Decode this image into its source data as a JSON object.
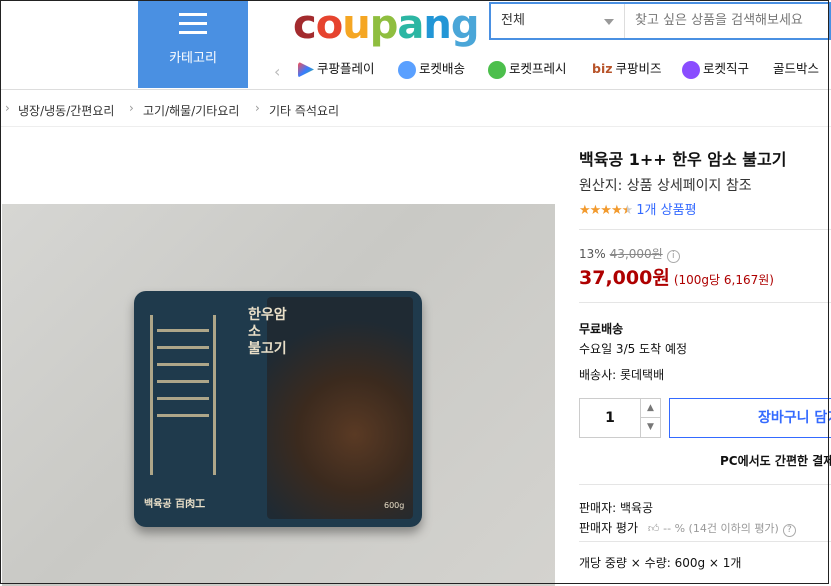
{
  "header": {
    "category_label": "카테고리",
    "logo_letters": [
      "c",
      "o",
      "u",
      "p",
      "a",
      "n",
      "g"
    ],
    "logo_colors": [
      "#a32b2e",
      "#e6442f",
      "#f5a623",
      "#8fbe3f",
      "#2cb6a3",
      "#2296d6",
      "#4aa6d8"
    ],
    "search": {
      "category_selected": "전체",
      "placeholder": "찾고 싶은 상품을 검색해보세요"
    },
    "nav": [
      {
        "label": "쿠팡플레이",
        "icon": "play-icon"
      },
      {
        "label": "로켓배송",
        "icon": "rocket-icon"
      },
      {
        "label": "로켓프레시",
        "icon": "rocket-fresh-icon"
      },
      {
        "label": "쿠팡비즈",
        "icon": "biz-icon",
        "prefix": "biz"
      },
      {
        "label": "로켓직구",
        "icon": "rocket-global-icon"
      },
      {
        "label": "골드박스",
        "icon": ""
      }
    ]
  },
  "breadcrumb": [
    "냉장/냉동/간편요리",
    "고기/해물/기타요리",
    "기타 즉석요리"
  ],
  "image": {
    "title_vertical": "한우암소\n불고기",
    "brand": "백육공 百肉工",
    "weight": "600g"
  },
  "product": {
    "title": "백육공 1++ 한우 암소 불고기",
    "origin": "원산지: 상품 상세페이지 참조",
    "rating": 4.5,
    "review_count": "1개 상품평",
    "discount_rate": "13%",
    "original_price": "43,000원",
    "price": "37,000원",
    "unit_price": "(100g당 6,167원)",
    "shipping": "무료배송",
    "arrival": "수요일 3/5 도착 예정",
    "carrier": "배송사: 롯데택배",
    "quantity": "1",
    "cart_button": "장바구니 담기",
    "pc_note": "PC에서도 간편한 결제",
    "seller": "판매자: 백육공",
    "seller_rating_label": "판매자 평가",
    "seller_rating_value": "-- % (14건 이하의 평가)",
    "option_line": "개당 중량 × 수량: 600g × 1개"
  }
}
